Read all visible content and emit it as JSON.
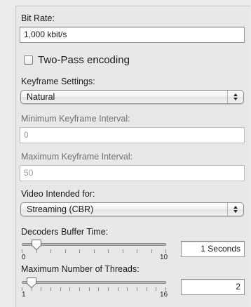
{
  "bit_rate": {
    "label": "Bit Rate:",
    "value": "1,000 kbit/s"
  },
  "two_pass": {
    "label": "Two-Pass encoding",
    "checked": false
  },
  "keyframe_settings": {
    "label": "Keyframe Settings:",
    "selected": "Natural"
  },
  "min_keyframe": {
    "label": "Minimum Keyframe Interval:",
    "value": "0"
  },
  "max_keyframe": {
    "label": "Maximum Keyframe Interval:",
    "value": "50"
  },
  "video_intended": {
    "label": "Video Intended for:",
    "selected": "Streaming (CBR)"
  },
  "decoders_buffer": {
    "label": "Decoders Buffer Time:",
    "min_label": "0",
    "max_label": "10",
    "min": 0,
    "max": 10,
    "value": 1,
    "field_value": "1 Seconds"
  },
  "threads": {
    "label": "Maximum Number of Threads:",
    "min_label": "1",
    "max_label": "16",
    "min": 1,
    "max": 16,
    "value": 2,
    "field_value": "2"
  }
}
